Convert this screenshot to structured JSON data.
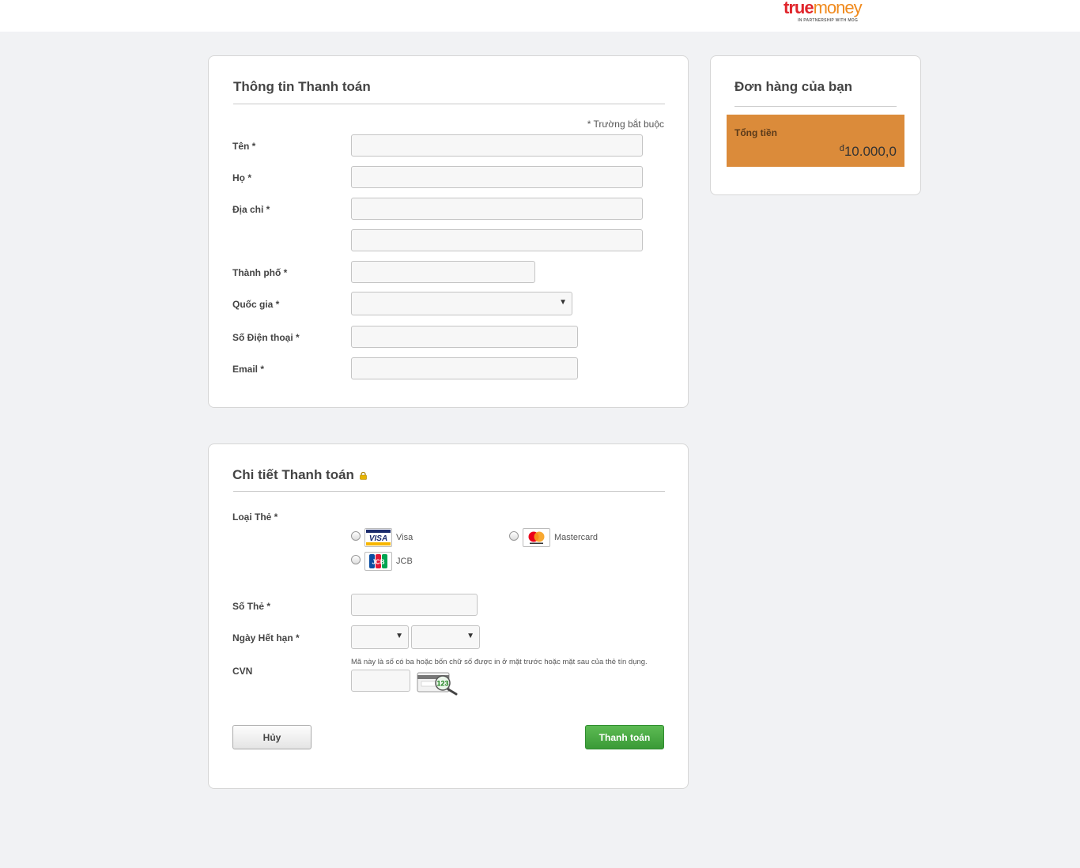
{
  "header": {
    "logo_true": "true",
    "logo_money": "money",
    "logo_tagline": "IN PARTNERSHIP WITH MOG"
  },
  "billing": {
    "title": "Thông tin Thanh toán",
    "required_note": "* Trường bắt buộc",
    "first_name_label": "Tên *",
    "last_name_label": "Họ *",
    "address_label": "Địa chỉ *",
    "city_label": "Thành phố *",
    "country_label": "Quốc gia *",
    "phone_label": "Số Điện thoại *",
    "email_label": "Email *",
    "first_name_value": "",
    "last_name_value": "",
    "address1_value": "",
    "address2_value": "",
    "city_value": "",
    "country_value": "",
    "phone_value": "",
    "email_value": ""
  },
  "payment": {
    "title": "Chi tiết Thanh toán",
    "card_type_label": "Loại Thẻ *",
    "card_types": [
      {
        "name": "Visa",
        "icon": "visa-logo-icon"
      },
      {
        "name": "Mastercard",
        "icon": "mastercard-logo-icon"
      },
      {
        "name": "JCB",
        "icon": "jcb-logo-icon"
      }
    ],
    "card_number_label": "Số Thẻ *",
    "expiry_label": "Ngày Hết hạn *",
    "cvn_label": "CVN",
    "cvn_hint": "Mã này là số có ba hoặc bốn chữ số được in ở mặt trước hoặc mặt sau của thẻ tín dụng.",
    "cvn_icon_text": "123",
    "cancel_label": "Hủy",
    "pay_label": "Thanh toán"
  },
  "order": {
    "title": "Đơn hàng của bạn",
    "total_label": "Tổng tiền",
    "currency_symbol": "đ",
    "total_value": "10.000,0"
  },
  "colors": {
    "total_bg": "#db8b3a",
    "pay_button": "#3a9a37",
    "lock_icon": "#e8b400"
  }
}
